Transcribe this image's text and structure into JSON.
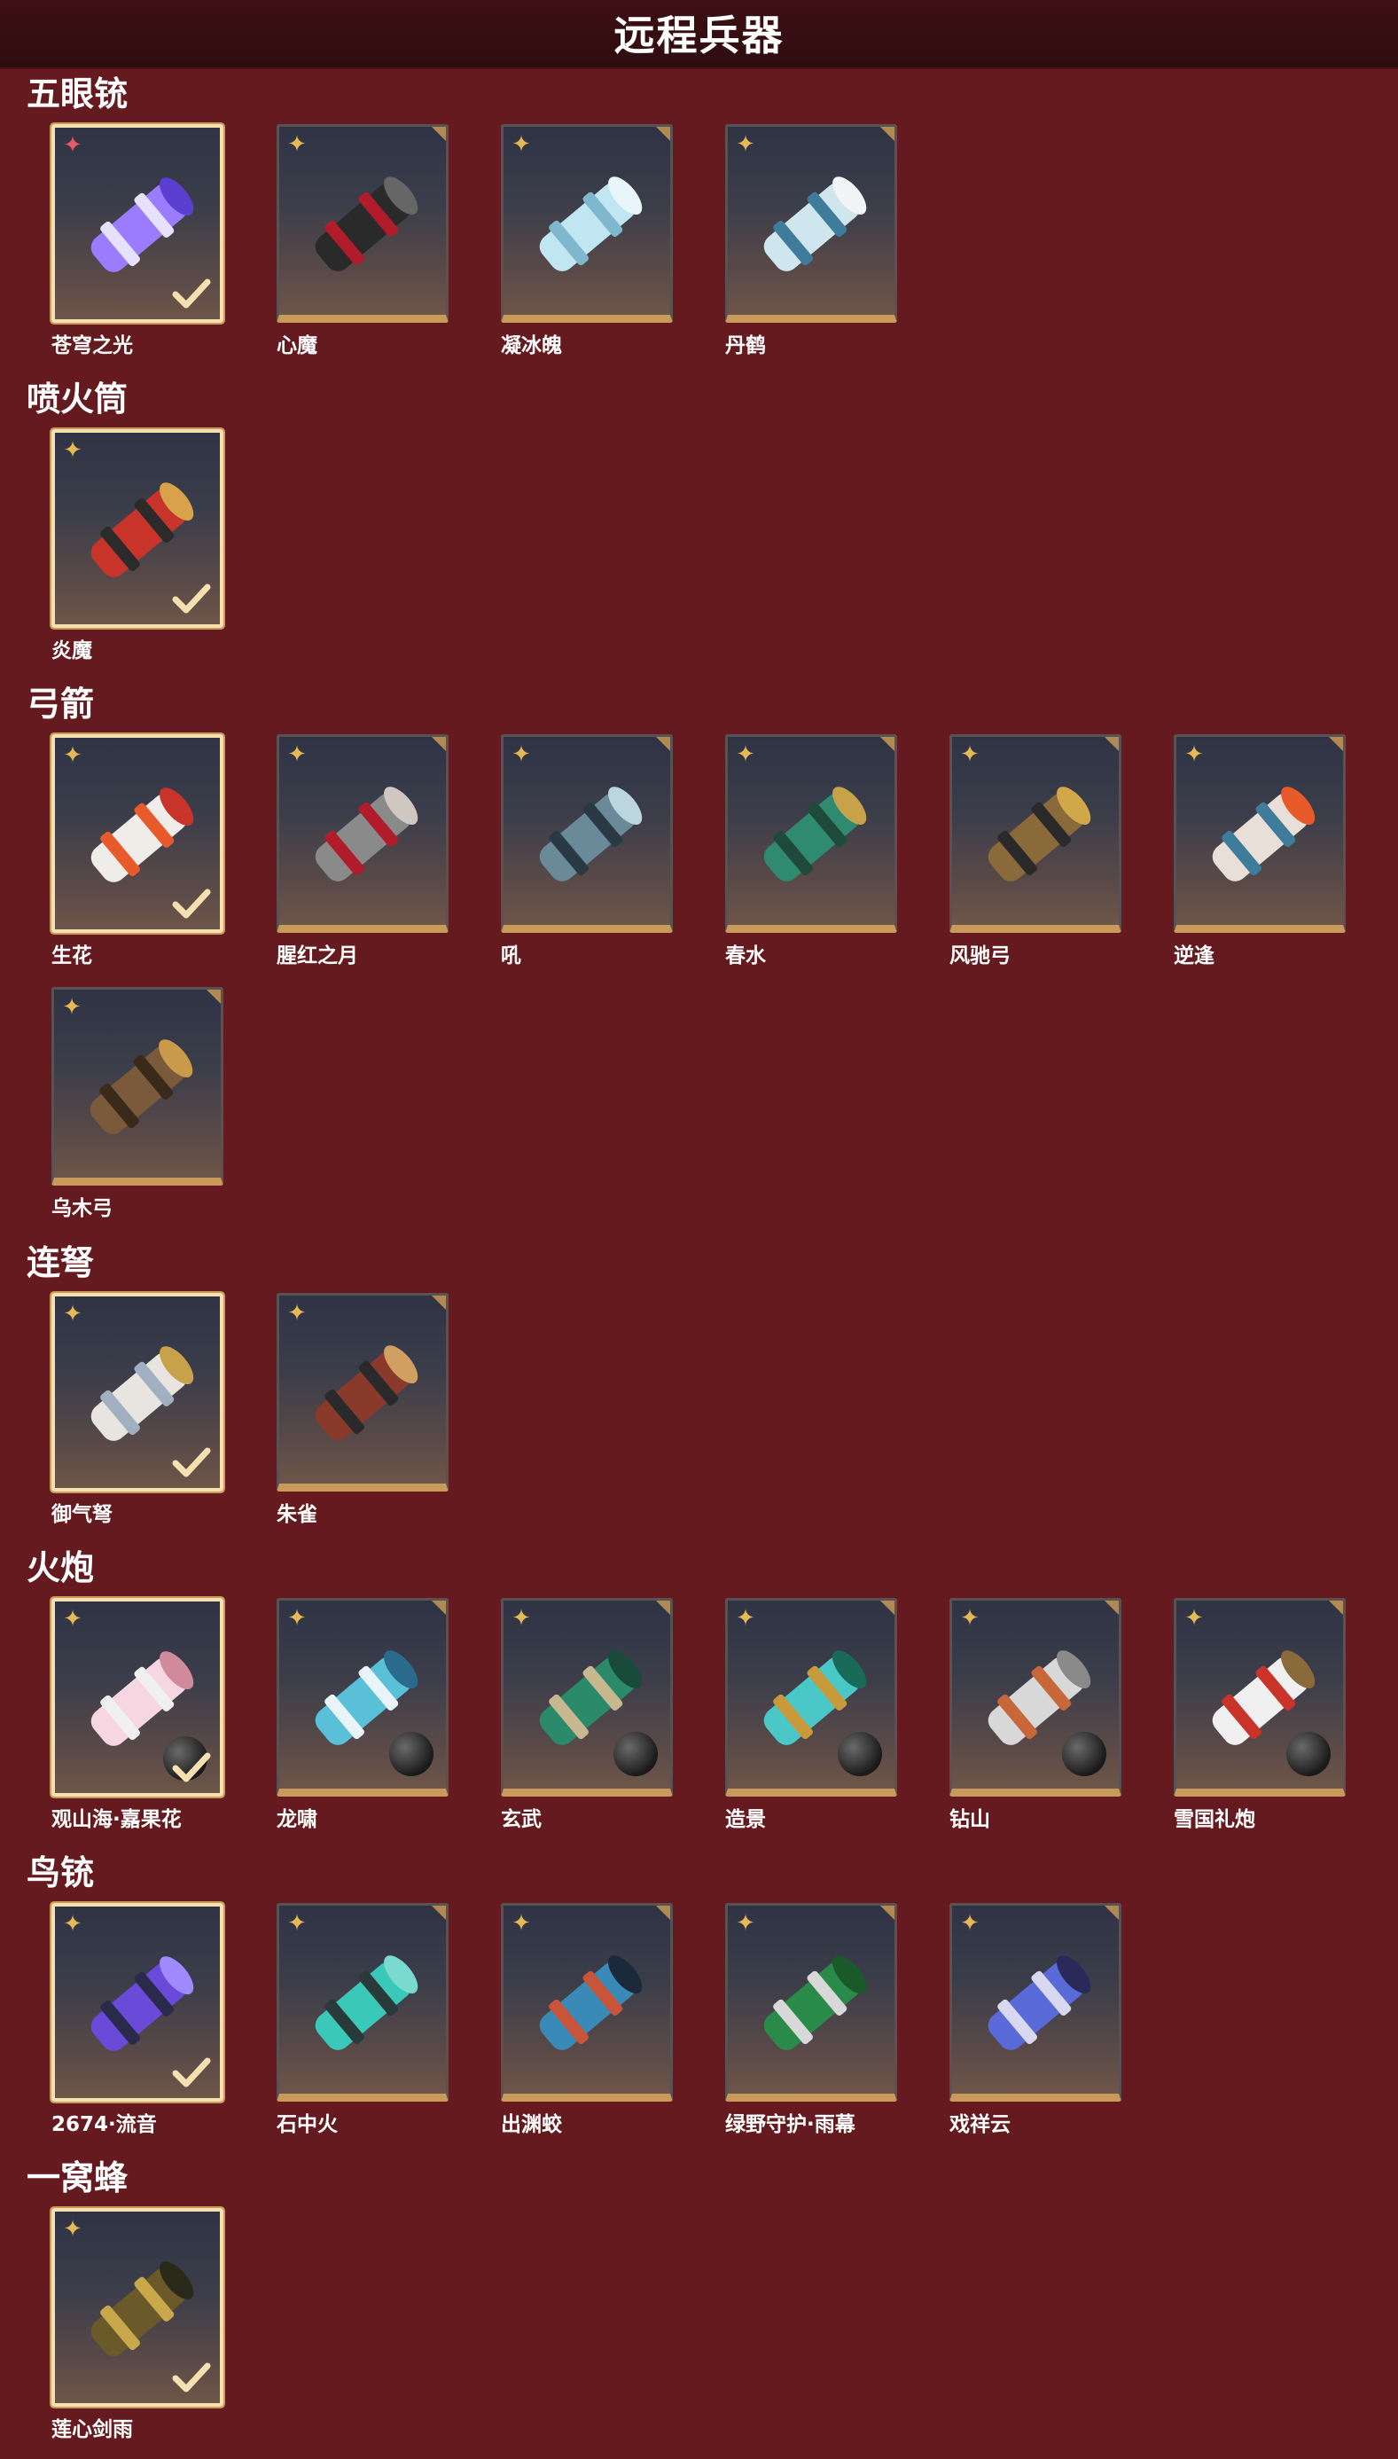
{
  "header": {
    "title": "远程兵器"
  },
  "sections": [
    {
      "title": "五眼铳",
      "items": [
        "苍穹之光",
        "心魔",
        "凝冰魄",
        "丹鹤"
      ]
    },
    {
      "title": "喷火筒",
      "items": [
        "炎魔"
      ]
    },
    {
      "title": "弓箭",
      "items": [
        "生花",
        "腥红之月",
        "吼",
        "春水",
        "风驰弓",
        "逆逢",
        "乌木弓"
      ]
    },
    {
      "title": "连弩",
      "items": [
        "御气弩",
        "朱雀"
      ]
    },
    {
      "title": "火炮",
      "items": [
        "观山海·嘉果花",
        "龙啸",
        "玄武",
        "造景",
        "钻山",
        "雪国礼炮"
      ]
    },
    {
      "title": "鸟铳",
      "items": [
        "2674·流音",
        "石中火",
        "出渊蛟",
        "绿野守护·雨幕",
        "戏祥云"
      ]
    },
    {
      "title": "一窝蜂",
      "items": [
        "莲心剑雨"
      ]
    }
  ],
  "colors": {
    "background": "#641a1e",
    "header": "#3a0f13",
    "tile_rim": "#c99a5a",
    "selected_border": "#f6e0b0",
    "star": "#e6b957"
  }
}
